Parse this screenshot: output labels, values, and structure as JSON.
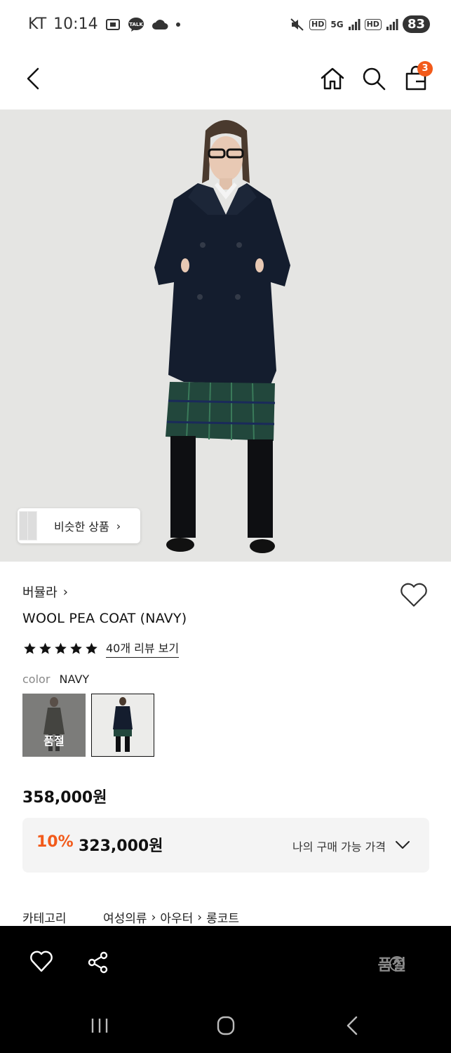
{
  "status_bar": {
    "carrier": "KT",
    "time": "10:14",
    "talk_badge": "TALK",
    "network_5g": "5G",
    "hd_1": "HD",
    "hd_2": "HD",
    "battery": "83"
  },
  "header": {
    "cart_count": "3"
  },
  "similar": {
    "label": "비슷한 상품",
    "chevron": "›"
  },
  "product": {
    "brand": "버뮬라",
    "brand_chevron": "›",
    "title": "WOOL PEA COAT (NAVY)",
    "rating_stars": 5,
    "review_link": "40개 리뷰 보기",
    "color_label": "color",
    "color_value": "NAVY",
    "swatches": [
      {
        "overlay_text": "품절"
      },
      {
        "overlay_text": ""
      }
    ],
    "price": "358,000원",
    "discount": {
      "rate": "10%",
      "price": "323,000원",
      "label": "나의 구매 가능 가격"
    },
    "category": {
      "label": "카테고리",
      "path": [
        "여성의류",
        "아우터",
        "롱코트"
      ],
      "separator": "›"
    }
  },
  "action_bar": {
    "status": "품절"
  },
  "colors": {
    "accent": "#f25a1a",
    "price_box_bg": "#f4f4f4",
    "action_bar_bg": "#000000",
    "soldout_text": "#8a8a8a"
  },
  "icons": {
    "back": "chevron-left-icon",
    "home": "home-icon",
    "search": "search-icon",
    "cart": "cart-icon",
    "like": "heart-icon",
    "share": "share-icon",
    "help": "question-icon"
  }
}
